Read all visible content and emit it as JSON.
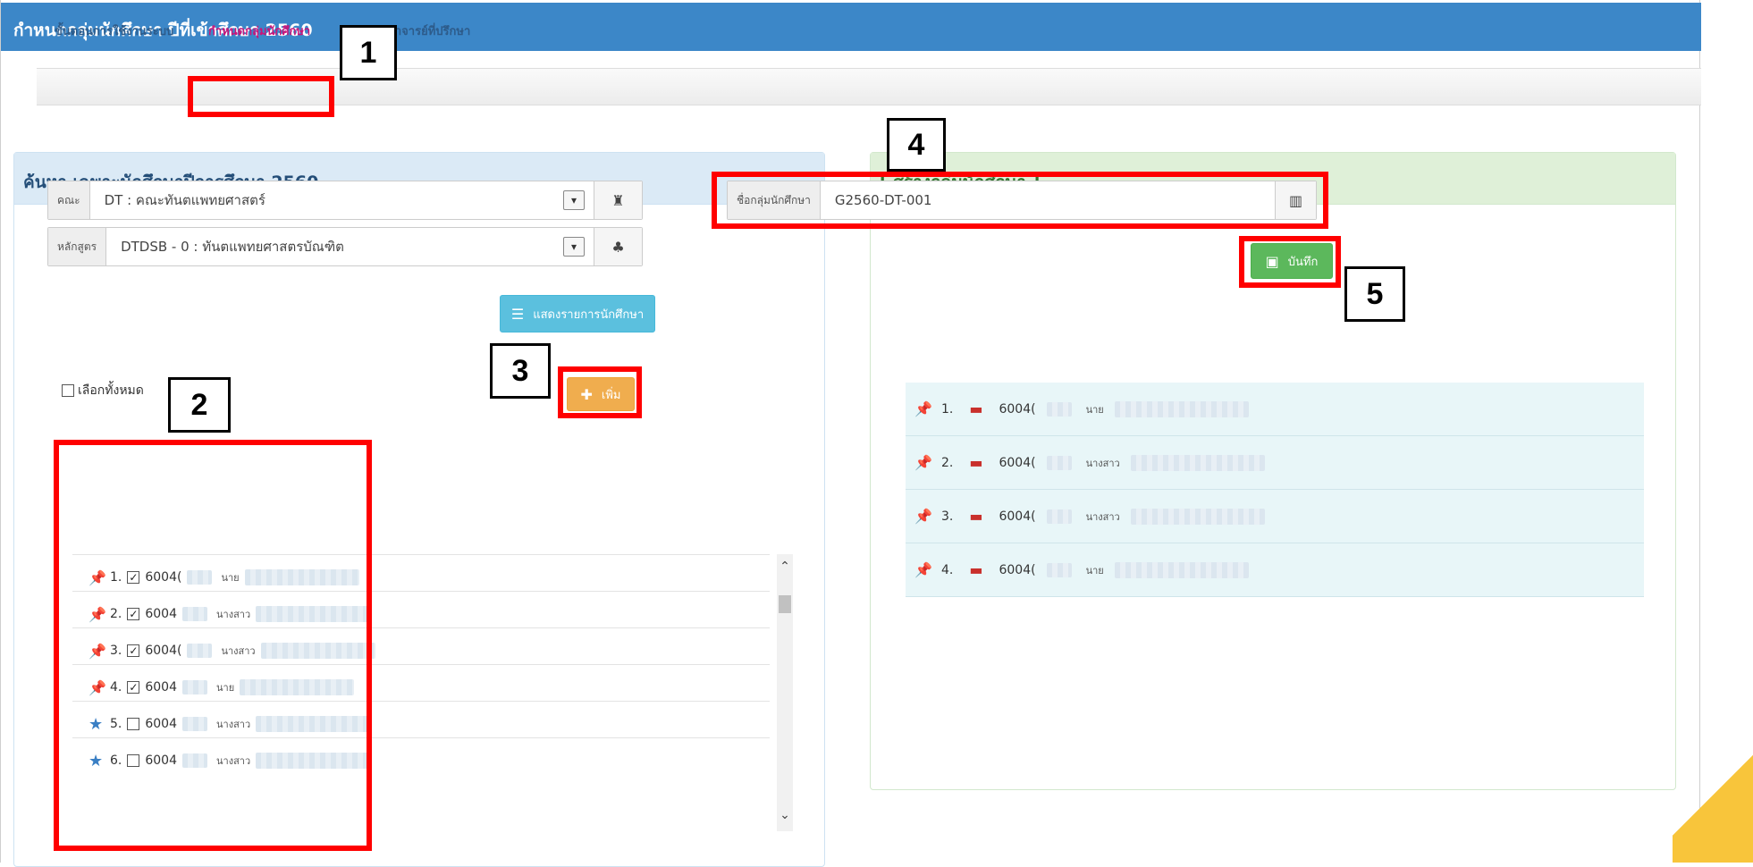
{
  "window": {
    "title": "กำหนดกลุ่มนักศึกษา ปีที่เข้าศึกษา 2560"
  },
  "tabs": [
    {
      "label": "ขั้นตอนการใช้งานระบบ",
      "active": false
    },
    {
      "label": "กำหนดกลุ่มนักศึกษา",
      "active": true
    },
    {
      "label": "กำหนดอาจารย์ที่ปรึกษา",
      "active": false
    }
  ],
  "search_panel": {
    "title": "ค้นหา เฉพาะนักศึกษาปีการศึกษา 2560",
    "faculty": {
      "label": "คณะ",
      "value": "DT : คณะทันตแพทยศาสตร์"
    },
    "curriculum": {
      "label": "หลักสูตร",
      "value": "DTDSB - 0 : ทันตแพทยศาสตรบัณฑิต"
    },
    "show_button": "แสดงรายการนักศึกษา",
    "select_all": "เลือกทั้งหมด",
    "add_button": "เพิ่ม",
    "students": [
      {
        "index": "1.",
        "checked": true,
        "pinned": true,
        "id": "6004(",
        "prefix": "นาย"
      },
      {
        "index": "2.",
        "checked": true,
        "pinned": true,
        "id": "6004",
        "prefix": "นางสาว"
      },
      {
        "index": "3.",
        "checked": true,
        "pinned": true,
        "id": "6004(",
        "prefix": "นางสาว"
      },
      {
        "index": "4.",
        "checked": true,
        "pinned": true,
        "id": "6004",
        "prefix": "นาย"
      },
      {
        "index": "5.",
        "checked": false,
        "pinned": false,
        "id": "6004",
        "prefix": "นางสาว"
      },
      {
        "index": "6.",
        "checked": false,
        "pinned": false,
        "id": "6004",
        "prefix": "นางสาว"
      }
    ]
  },
  "group_panel": {
    "title": "[ สร้างกลุ่มนักศึกษา ]",
    "group_name_label": "ชื่อกลุ่มนักศึกษา",
    "group_name_value": "G2560-DT-001",
    "save_button": "บันทึก",
    "members": [
      {
        "index": "1.",
        "id": "6004(",
        "prefix": "นาย"
      },
      {
        "index": "2.",
        "id": "6004(",
        "prefix": "นางสาว"
      },
      {
        "index": "3.",
        "id": "6004(",
        "prefix": "นางสาว"
      },
      {
        "index": "4.",
        "id": "6004(",
        "prefix": "นาย"
      }
    ]
  },
  "callouts": [
    "1",
    "2",
    "3",
    "4",
    "5"
  ],
  "colors": {
    "title_bar": "#3c87c8",
    "callout": "#ff0000",
    "active_tab": "#c8157a"
  }
}
